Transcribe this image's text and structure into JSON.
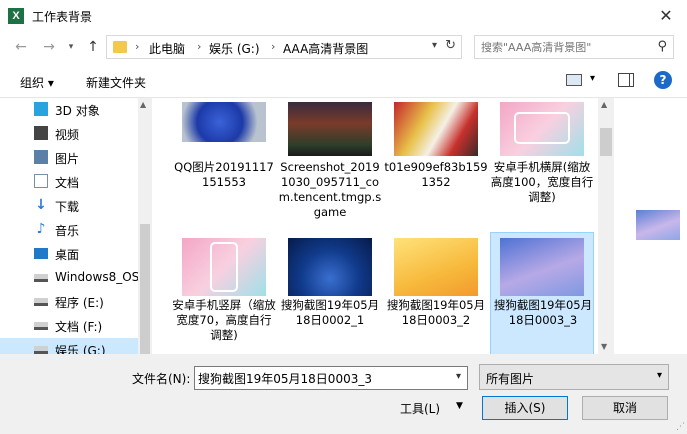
{
  "window": {
    "title": "工作表背景",
    "app_icon_letter": "X",
    "close": "✕"
  },
  "nav": {
    "back": "←",
    "forward": "→",
    "up": "↑",
    "breadcrumbs": [
      "此电脑",
      "娱乐 (G:)",
      "AAA高清背景图"
    ],
    "search_placeholder": "搜索\"AAA高清背景图\""
  },
  "toolbar": {
    "organize": "组织 ▾",
    "new_folder": "新建文件夹",
    "help": "?"
  },
  "sidebar": {
    "items": [
      {
        "label": "3D 对象",
        "icon": "cube-icon",
        "color": "#29a3e0"
      },
      {
        "label": "视频",
        "icon": "video-icon",
        "color": "#444444"
      },
      {
        "label": "图片",
        "icon": "picture-icon",
        "color": "#5b7fa6"
      },
      {
        "label": "文档",
        "icon": "document-icon",
        "color": "#7a8ea8"
      },
      {
        "label": "下载",
        "icon": "download-icon",
        "color": "#2a7bd5"
      },
      {
        "label": "音乐",
        "icon": "music-icon",
        "color": "#2a7bd5"
      },
      {
        "label": "桌面",
        "icon": "desktop-icon",
        "color": "#1f78c8"
      },
      {
        "label": "Windows8_OS",
        "icon": "drive-icon",
        "color": "#555555"
      },
      {
        "label": "程序 (E:)",
        "icon": "drive-icon",
        "color": "#555555"
      },
      {
        "label": "文档 (F:)",
        "icon": "drive-icon",
        "color": "#555555"
      },
      {
        "label": "娱乐 (G:)",
        "icon": "drive-icon",
        "color": "#555555"
      }
    ]
  },
  "files": [
    {
      "name": "QQ图片20191117151553",
      "thumb": "blue-rose",
      "selected": false
    },
    {
      "name": "Screenshot_20191030_095711_com.tencent.tmgp.sgame",
      "thumb": "game-screenshot",
      "selected": false
    },
    {
      "name": "t01e909ef83b1591352",
      "thumb": "anime-hero",
      "selected": false
    },
    {
      "name": "安卓手机横屏(缩放高度100，宽度自行调整)",
      "thumb": "pink-phone-landscape",
      "selected": false
    },
    {
      "name": "安卓手机竖屏（缩放宽度70，高度自行调整)",
      "thumb": "pink-phone-portrait",
      "selected": false
    },
    {
      "name": "搜狗截图19年05月18日0002_1",
      "thumb": "night-blue",
      "selected": false
    },
    {
      "name": "搜狗截图19年05月18日0003_2",
      "thumb": "yellow-gradient",
      "selected": false
    },
    {
      "name": "搜狗截图19年05月18日0003_3",
      "thumb": "purple-wave",
      "selected": true
    }
  ],
  "footer": {
    "filename_label": "文件名(N):",
    "filename_value": "搜狗截图19年05月18日0003_3",
    "filetype": "所有图片",
    "tools": "工具(L)",
    "insert": "插入(S)",
    "cancel": "取消"
  }
}
